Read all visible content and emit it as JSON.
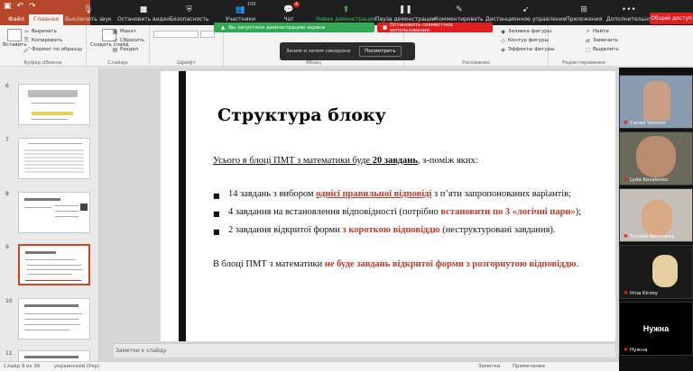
{
  "ppt": {
    "tab_file": "Файл",
    "tab_home": "Главная"
  },
  "zoom": {
    "mute_label": "Выключить звук",
    "video_label": "Остановить видео",
    "security_label": "Безопасность",
    "participants_label": "Участники",
    "participants_count": "100",
    "chat_label": "Чат",
    "chat_badge": "4",
    "new_share_label": "Новая демонстрация",
    "pause_share_label": "Пауза демонстрации",
    "annotate_label": "Комментировать",
    "remote_label": "Дистанционное управление",
    "apps_label": "Приложения",
    "more_label": "Дополнительно",
    "end_label": "Общий доступ"
  },
  "ribbon": {
    "insert_label": "Вставить",
    "cut_label": "Вырезать",
    "copy_label": "Копировать",
    "format_painter_label": "Формат по образцу",
    "clipboard_group": "Буфер обмена",
    "new_slide_label": "Создать слайд",
    "layout_label": "Макет",
    "reset_label": "Сбросить",
    "section_label": "Раздел",
    "slides_group": "Слайды",
    "font_group": "Шрифт",
    "paragraph_group": "Абзац",
    "drawing_group": "Рисование",
    "shape_fill_label": "Заливка фигуры",
    "shape_outline_label": "Контур фигуры",
    "shape_effects_label": "Эффекты фигуры",
    "find_label": "Найти",
    "replace_label": "Заменить",
    "select_label": "Выделить",
    "editing_group": "Редактирование"
  },
  "share": {
    "green_text": "Вы запустили демонстрацию экрана",
    "red_text": "Остановить совместное использование"
  },
  "notification": {
    "text": "Зачем и зачем синхрони",
    "view_button": "Посмотреть"
  },
  "thumbnails": {
    "numbers": [
      "6",
      "7",
      "8",
      "9",
      "10",
      "11"
    ]
  },
  "slide": {
    "title": "Структура блоку",
    "intro_a": "Усього в блоці ПМТ з математики буде ",
    "intro_b": "20 завдань",
    "intro_c": ", з-поміж яких:",
    "b1_a": "14 завдань з вибором ",
    "b1_b": "однієї правильної відповіді",
    "b1_c": " з п’яти запропонованих варіантів;",
    "b2_a": "4 завдання на встановлення відповідності (потрібно ",
    "b2_b": "встановити по 3 «логічні пари»",
    "b2_c": ");",
    "b3_a": "2 завдання відкритої форми ",
    "b3_b": "з короткою відповіддю",
    "b3_c": " (неструктуровані завдання).",
    "final_a": "В блоці ПМТ з математики ",
    "final_b": "не буде завдань відкритої форми з розгорнутою відповіддю",
    "final_c": "."
  },
  "notes": {
    "placeholder": "Заметки к слайду"
  },
  "videos": [
    {
      "name": "Cersei Voronin"
    },
    {
      "name": "Lyda Kovalenko"
    },
    {
      "name": "Тетяна Веселова"
    },
    {
      "name": "Irina Kirzey"
    },
    {
      "name": "Нужна"
    }
  ],
  "status": {
    "slide_of": "Слайд 9 из 36",
    "language": "украинский (Укр)",
    "notes_btn": "Заметки",
    "comments_btn": "Примечания"
  },
  "colors": {
    "ppt_red": "#b7472a",
    "zoom_green": "#34a853",
    "zoom_red": "#e02020",
    "slide_red_text": "#c0392b"
  }
}
